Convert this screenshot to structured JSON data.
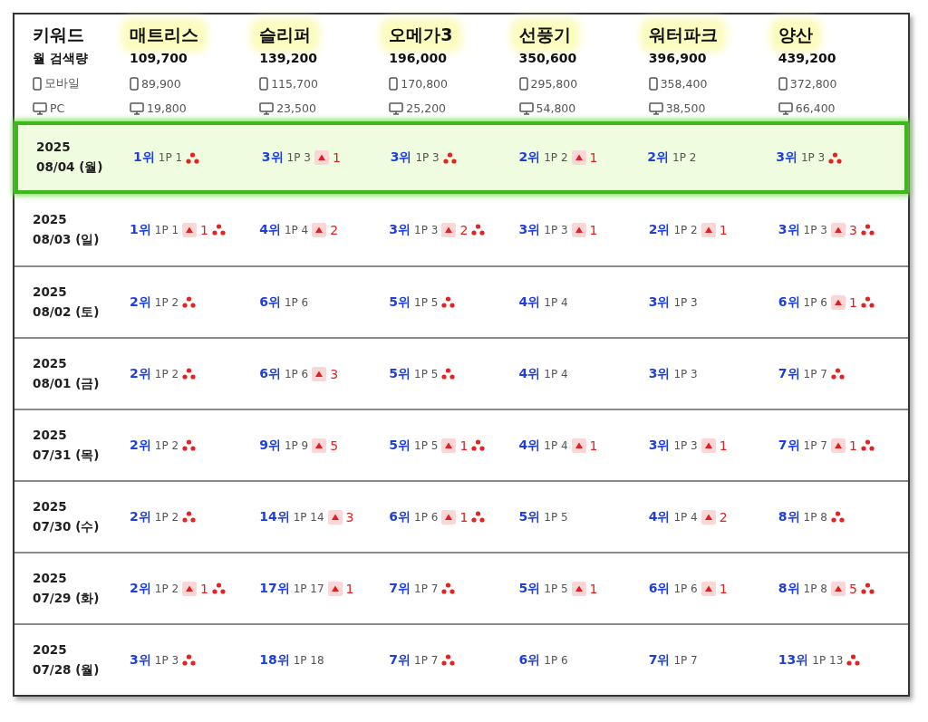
{
  "header": {
    "keyword_label": "키워드",
    "volume_label": "월 검색량",
    "mobile_label": "모바일",
    "pc_label": "PC"
  },
  "keywords": [
    {
      "name": "매트리스",
      "total": "109,700",
      "mobile": "89,900",
      "pc": "19,800"
    },
    {
      "name": "슬리퍼",
      "total": "139,200",
      "mobile": "115,700",
      "pc": "23,500"
    },
    {
      "name": "오메가3",
      "total": "196,000",
      "mobile": "170,800",
      "pc": "25,200"
    },
    {
      "name": "선풍기",
      "total": "350,600",
      "mobile": "295,800",
      "pc": "54,800"
    },
    {
      "name": "워터파크",
      "total": "396,900",
      "mobile": "358,400",
      "pc": "38,500"
    },
    {
      "name": "양산",
      "total": "439,200",
      "mobile": "372,800",
      "pc": "66,400"
    }
  ],
  "rows": [
    {
      "year": "2025",
      "date": "08/04 (월)",
      "selected": true,
      "cells": [
        {
          "rank": "1위",
          "page": "1P 1",
          "dots": true
        },
        {
          "rank": "3위",
          "page": "1P 3",
          "change": "1",
          "dots": false
        },
        {
          "rank": "3위",
          "page": "1P 3",
          "dots": true
        },
        {
          "rank": "2위",
          "page": "1P 2",
          "change": "1",
          "dots": false
        },
        {
          "rank": "2위",
          "page": "1P 2",
          "dots": false
        },
        {
          "rank": "3위",
          "page": "1P 3",
          "dots": true
        }
      ]
    },
    {
      "year": "2025",
      "date": "08/03 (일)",
      "selected": false,
      "cells": [
        {
          "rank": "1위",
          "page": "1P 1",
          "change": "1",
          "dots": true
        },
        {
          "rank": "4위",
          "page": "1P 4",
          "change": "2",
          "dots": false
        },
        {
          "rank": "3위",
          "page": "1P 3",
          "change": "2",
          "dots": true
        },
        {
          "rank": "3위",
          "page": "1P 3",
          "change": "1",
          "dots": false
        },
        {
          "rank": "2위",
          "page": "1P 2",
          "change": "1",
          "dots": false
        },
        {
          "rank": "3위",
          "page": "1P 3",
          "change": "3",
          "dots": true
        }
      ]
    },
    {
      "year": "2025",
      "date": "08/02 (토)",
      "selected": false,
      "cells": [
        {
          "rank": "2위",
          "page": "1P 2",
          "dots": true
        },
        {
          "rank": "6위",
          "page": "1P 6",
          "dots": false
        },
        {
          "rank": "5위",
          "page": "1P 5",
          "dots": true
        },
        {
          "rank": "4위",
          "page": "1P 4",
          "dots": false
        },
        {
          "rank": "3위",
          "page": "1P 3",
          "dots": false
        },
        {
          "rank": "6위",
          "page": "1P 6",
          "change": "1",
          "dots": true
        }
      ]
    },
    {
      "year": "2025",
      "date": "08/01 (금)",
      "selected": false,
      "cells": [
        {
          "rank": "2위",
          "page": "1P 2",
          "dots": true
        },
        {
          "rank": "6위",
          "page": "1P 6",
          "change": "3",
          "dots": false
        },
        {
          "rank": "5위",
          "page": "1P 5",
          "dots": true
        },
        {
          "rank": "4위",
          "page": "1P 4",
          "dots": false
        },
        {
          "rank": "3위",
          "page": "1P 3",
          "dots": false
        },
        {
          "rank": "7위",
          "page": "1P 7",
          "dots": true
        }
      ]
    },
    {
      "year": "2025",
      "date": "07/31 (목)",
      "selected": false,
      "cells": [
        {
          "rank": "2위",
          "page": "1P 2",
          "dots": true
        },
        {
          "rank": "9위",
          "page": "1P 9",
          "change": "5",
          "dots": false
        },
        {
          "rank": "5위",
          "page": "1P 5",
          "change": "1",
          "dots": true
        },
        {
          "rank": "4위",
          "page": "1P 4",
          "change": "1",
          "dots": false
        },
        {
          "rank": "3위",
          "page": "1P 3",
          "change": "1",
          "dots": false
        },
        {
          "rank": "7위",
          "page": "1P 7",
          "change": "1",
          "dots": true
        }
      ]
    },
    {
      "year": "2025",
      "date": "07/30 (수)",
      "selected": false,
      "cells": [
        {
          "rank": "2위",
          "page": "1P 2",
          "dots": true
        },
        {
          "rank": "14위",
          "page": "1P 14",
          "change": "3",
          "dots": false
        },
        {
          "rank": "6위",
          "page": "1P 6",
          "change": "1",
          "dots": true
        },
        {
          "rank": "5위",
          "page": "1P 5",
          "dots": false
        },
        {
          "rank": "4위",
          "page": "1P 4",
          "change": "2",
          "dots": false
        },
        {
          "rank": "8위",
          "page": "1P 8",
          "dots": true
        }
      ]
    },
    {
      "year": "2025",
      "date": "07/29 (화)",
      "selected": false,
      "cells": [
        {
          "rank": "2위",
          "page": "1P 2",
          "change": "1",
          "dots": true
        },
        {
          "rank": "17위",
          "page": "1P 17",
          "change": "1",
          "dots": false
        },
        {
          "rank": "7위",
          "page": "1P 7",
          "dots": true
        },
        {
          "rank": "5위",
          "page": "1P 5",
          "change": "1",
          "dots": false
        },
        {
          "rank": "6위",
          "page": "1P 6",
          "change": "1",
          "dots": false
        },
        {
          "rank": "8위",
          "page": "1P 8",
          "change": "5",
          "dots": true
        }
      ]
    },
    {
      "year": "2025",
      "date": "07/28 (월)",
      "selected": false,
      "cells": [
        {
          "rank": "3위",
          "page": "1P 3",
          "dots": true
        },
        {
          "rank": "18위",
          "page": "1P 18",
          "dots": false
        },
        {
          "rank": "7위",
          "page": "1P 7",
          "dots": true
        },
        {
          "rank": "6위",
          "page": "1P 6",
          "dots": false
        },
        {
          "rank": "7위",
          "page": "1P 7",
          "dots": false
        },
        {
          "rank": "13위",
          "page": "1P 13",
          "dots": true
        }
      ]
    }
  ]
}
